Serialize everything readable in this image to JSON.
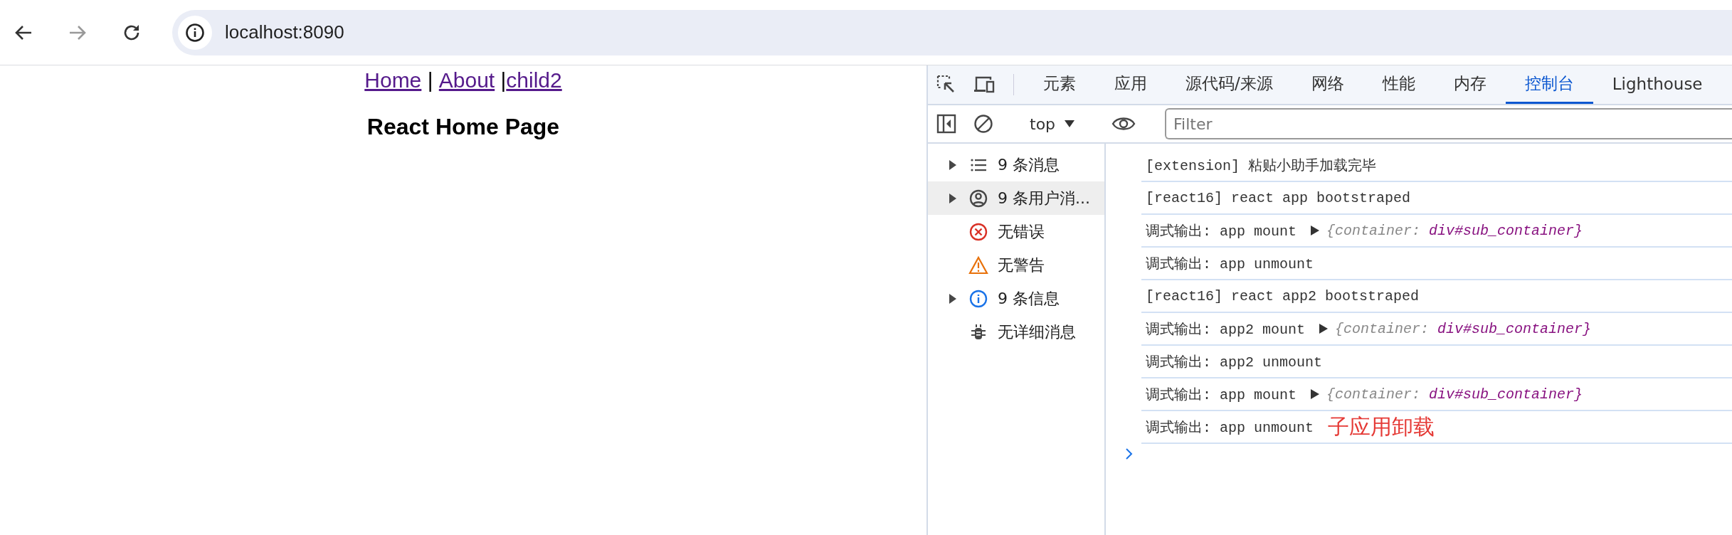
{
  "browser": {
    "url": "localhost:8090"
  },
  "page": {
    "nav": [
      {
        "kind": "link",
        "text": "Home"
      },
      {
        "kind": "text",
        "text": " | "
      },
      {
        "kind": "link",
        "text": "About"
      },
      {
        "kind": "text",
        "text": " |"
      },
      {
        "kind": "link",
        "text": "child2"
      }
    ],
    "heading": "React Home Page"
  },
  "devtools": {
    "tabs": [
      {
        "label": "元素",
        "selected": false
      },
      {
        "label": "应用",
        "selected": false
      },
      {
        "label": "源代码/来源",
        "selected": false
      },
      {
        "label": "网络",
        "selected": false
      },
      {
        "label": "性能",
        "selected": false
      },
      {
        "label": "内存",
        "selected": false
      },
      {
        "label": "控制台",
        "selected": true
      },
      {
        "label": "Lighthouse",
        "selected": false
      }
    ],
    "toolbar": {
      "context": "top",
      "filter_placeholder": "Filter"
    },
    "sidebar": {
      "items": [
        {
          "kind": "list",
          "label": "9 条消息",
          "expandable": true,
          "selected": false
        },
        {
          "kind": "user",
          "label": "9 条用户消...",
          "expandable": true,
          "selected": true
        },
        {
          "kind": "error",
          "label": "无错误",
          "expandable": false,
          "selected": false
        },
        {
          "kind": "warning",
          "label": "无警告",
          "expandable": false,
          "selected": false
        },
        {
          "kind": "info",
          "label": "9 条信息",
          "expandable": true,
          "selected": false
        },
        {
          "kind": "verbose",
          "label": "无详细消息",
          "expandable": false,
          "selected": false
        }
      ]
    },
    "messages": [
      {
        "text": "[extension] 粘贴小助手加载完毕"
      },
      {
        "text": "[react16] react app bootstraped"
      },
      {
        "text": "调式输出: app mount",
        "preview_key": "{container:",
        "preview_value": "div#sub_container}"
      },
      {
        "text": "调式输出: app unmount"
      },
      {
        "text": "[react16] react app2 bootstraped"
      },
      {
        "text": "调式输出: app2 mount",
        "preview_key": "{container:",
        "preview_value": "div#sub_container}"
      },
      {
        "text": "调式输出: app2 unmount"
      },
      {
        "text": "调式输出: app mount",
        "preview_key": "{container:",
        "preview_value": "div#sub_container}"
      },
      {
        "text": "调式输出: app unmount",
        "annotation": "子应用卸载"
      }
    ]
  }
}
